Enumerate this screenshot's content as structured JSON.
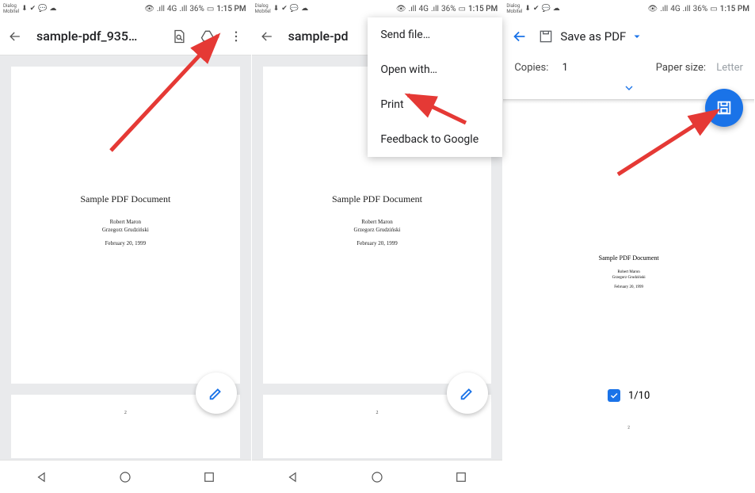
{
  "status": {
    "carrier1": "Dialog",
    "carrier2": "Mobitel",
    "battery": "36%",
    "time": "1:15 PM",
    "signal_indicator": "4G",
    "nfc": ".ıll"
  },
  "panel1": {
    "title": "sample-pdf_935…",
    "doc_title": "Sample PDF Document",
    "doc_author1": "Robert Maron",
    "doc_author2": "Grzegorz Grudziński",
    "doc_date": "February 20, 1999",
    "page2_idx": "2"
  },
  "panel2": {
    "title": "sample-pd",
    "menu": {
      "send": "Send file…",
      "open": "Open with…",
      "print": "Print",
      "feedback": "Feedback to Google"
    }
  },
  "panel3": {
    "printer": "Save as PDF",
    "copies_label": "Copies:",
    "copies_value": "1",
    "paper_label": "Paper size:",
    "paper_value": "Letter",
    "page_counter": "1/10",
    "mini_page2_idx": "2"
  },
  "colors": {
    "accent": "#1a73e8",
    "arrow": "#e53935"
  }
}
